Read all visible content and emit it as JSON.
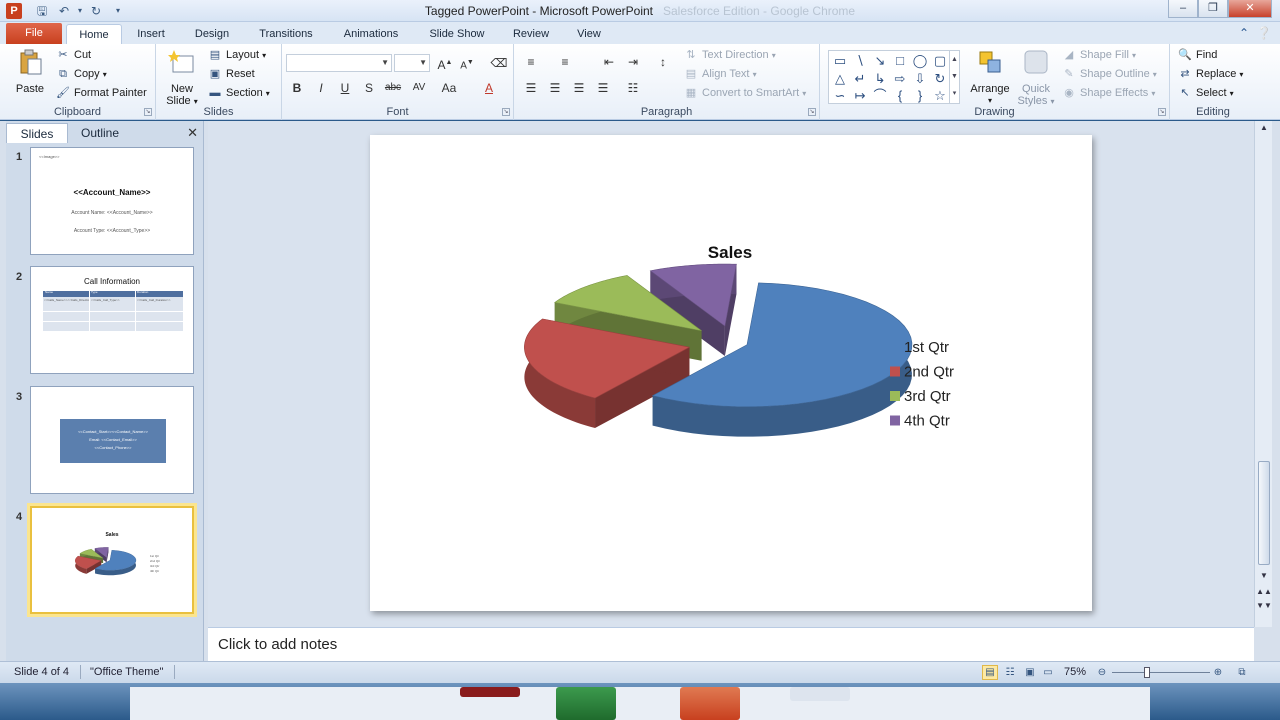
{
  "window": {
    "app_icon": "P",
    "title": "Tagged PowerPoint - Microsoft PowerPoint",
    "title_faded": "Salesforce Edition - Google Chrome"
  },
  "tabs": {
    "file": "File",
    "items": [
      "Home",
      "Insert",
      "Design",
      "Transitions",
      "Animations",
      "Slide Show",
      "Review",
      "View"
    ]
  },
  "ribbon": {
    "clipboard": {
      "label": "Clipboard",
      "paste": "Paste",
      "cut": "Cut",
      "copy": "Copy",
      "format_painter": "Format Painter"
    },
    "slides": {
      "label": "Slides",
      "new_slide_line1": "New",
      "new_slide_line2": "Slide",
      "layout": "Layout",
      "reset": "Reset",
      "section": "Section"
    },
    "font": {
      "label": "Font",
      "bold": "B",
      "italic": "I",
      "underline": "U",
      "shadow": "S",
      "strike": "abc",
      "spacing": "AV",
      "case": "Aa",
      "color": "A"
    },
    "paragraph": {
      "label": "Paragraph",
      "text_direction": "Text Direction",
      "align_text": "Align Text",
      "convert_smartart": "Convert to SmartArt"
    },
    "drawing": {
      "label": "Drawing",
      "arrange": "Arrange",
      "quick_styles_line1": "Quick",
      "quick_styles_line2": "Styles",
      "shape_fill": "Shape Fill",
      "shape_outline": "Shape Outline",
      "shape_effects": "Shape Effects"
    },
    "editing": {
      "label": "Editing",
      "find": "Find",
      "replace": "Replace",
      "select": "Select"
    }
  },
  "pane": {
    "tab_slides": "Slides",
    "tab_outline": "Outline",
    "thumbs": [
      {
        "num": "1",
        "title": "<<Account_Name>>",
        "line1": "Account Name: <<Account_Name>>",
        "line2": "Account Type: <<Account_Type>>",
        "corner": "<<Image>>"
      },
      {
        "num": "2",
        "title": "Call Information",
        "headers": [
          "Name",
          "Type",
          "Duration"
        ],
        "row": [
          "<<Calls_Name>><<Calls_Direction>>",
          "<<Calls_Call_Type>>",
          "<<Calls_Call_Duration>>"
        ]
      },
      {
        "num": "3",
        "lines": [
          "<<Contact_Start>><<Contact_Name>>",
          "Email: <<Contact_Email>>",
          "<<Contact_Phone>>"
        ]
      },
      {
        "num": "4",
        "title": "Sales",
        "legend": [
          "1st Qtr",
          "2nd Qtr",
          "3rd Qtr",
          "4th Qtr"
        ]
      }
    ]
  },
  "chart_data": {
    "type": "pie",
    "title": "Sales",
    "categories": [
      "1st Qtr",
      "2nd Qtr",
      "3rd Qtr",
      "4th Qtr"
    ],
    "values": [
      8.2,
      3.2,
      1.4,
      1.2
    ],
    "colors": [
      "#4f81bd",
      "#c0504d",
      "#9bbb59",
      "#8064a2"
    ],
    "style": "3D exploded",
    "legend_position": "right"
  },
  "notes": {
    "placeholder": "Click to add notes"
  },
  "status": {
    "slide": "Slide 4 of 4",
    "theme": "\"Office Theme\"",
    "zoom": "75%",
    "zoom_level": 0.75
  }
}
